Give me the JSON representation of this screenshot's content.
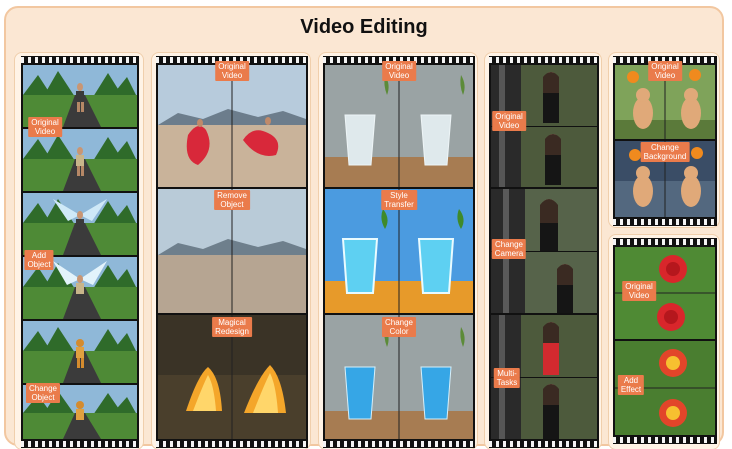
{
  "title": "Video Editing",
  "colors": {
    "accent": "#ea7b4b",
    "panel_bg": "#fff3e6",
    "outer_bg": "#fbe7d3"
  },
  "panels": {
    "runner": {
      "original": [
        "Original",
        "Video"
      ],
      "add_object": [
        "Add",
        "Object"
      ],
      "change_object": [
        "Change",
        "Object"
      ]
    },
    "beach": {
      "original": [
        "Original",
        "Video"
      ],
      "remove_object": [
        "Remove",
        "Object"
      ],
      "magical_redesign": [
        "Magical",
        "Redesign"
      ]
    },
    "glass": {
      "original": [
        "Original",
        "Video"
      ],
      "style_transfer": [
        "Style",
        "Transfer"
      ],
      "change_color": [
        "Change",
        "Color"
      ]
    },
    "woman": {
      "original": [
        "Original",
        "Video"
      ],
      "change_camera": [
        "Change",
        "Camera"
      ],
      "multi_tasks": [
        "Multi-",
        "Tasks"
      ]
    },
    "cat": {
      "original": [
        "Original",
        "Video"
      ],
      "change_background": [
        "Change",
        "Background"
      ]
    },
    "rose": {
      "original": [
        "Original",
        "Video"
      ],
      "add_effect": [
        "Add",
        "Effect"
      ]
    }
  }
}
